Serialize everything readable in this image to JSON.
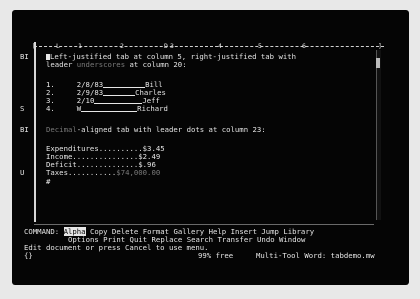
{
  "ruler": {
    "marks": [
      "[",
      "L",
      "1",
      "2",
      "D",
      "3",
      "4",
      "5",
      "6",
      "]"
    ]
  },
  "document": {
    "para1_style": "BI",
    "para1_line1a": "Left-justified tab at column 5, right-justified tab with",
    "para1_line2_prefix": "leader ",
    "para1_line2_dim": "underscores",
    "para1_line2_suffix": " at column 20:",
    "rows": [
      {
        "num": "1.",
        "date": "2/8/83",
        "name": "Bill"
      },
      {
        "num": "2.",
        "date": "2/9/83",
        "name": "Charles"
      },
      {
        "num": "3.",
        "date": "2/10",
        "name": "Jeff"
      },
      {
        "num": "4.",
        "date": "W",
        "name": "Richard"
      }
    ],
    "style_col_s": "S",
    "para2_style": "BI",
    "para2_dim": "Decimal",
    "para2_rest": "-aligned tab with leader dots at column 23:",
    "items": [
      {
        "label": "Expenditures..........",
        "value": "$3.45"
      },
      {
        "label": "Income...............",
        "value": "$2.49"
      },
      {
        "label": "Deficit..............",
        "value": "$.96"
      },
      {
        "label": "Taxes...........",
        "value": "$74,000.00"
      }
    ],
    "style_col_u": "U",
    "style_col_hash": "#"
  },
  "menu": {
    "command_label": "COMMAND:",
    "row1": [
      "Alpha",
      "Copy",
      "Delete",
      "Format",
      "Gallery",
      "Help",
      "Insert",
      "Jump",
      "Library"
    ],
    "row2": [
      "Options",
      "Print",
      "Quit",
      "Replace",
      "Search",
      "Transfer",
      "Undo",
      "Window"
    ],
    "message": "Edit document or press Cancel to use menu.",
    "position": "{}",
    "free": "99% free",
    "app_name": "Multi-Tool Word: tabdemo.mw"
  }
}
